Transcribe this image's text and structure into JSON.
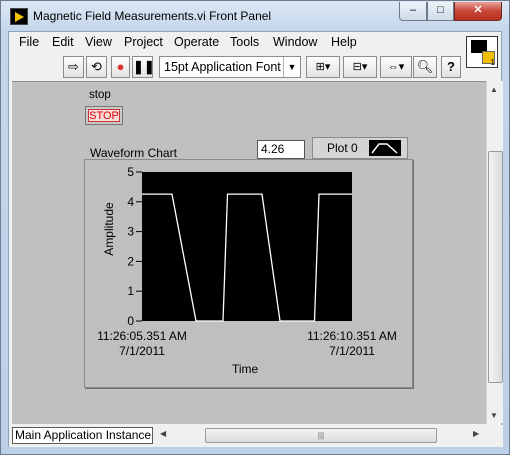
{
  "window": {
    "title": "Magnetic Field Measurements.vi Front Panel",
    "min": "–",
    "max": "□",
    "close": "✕"
  },
  "menu": [
    "File",
    "Edit",
    "View",
    "Project",
    "Operate",
    "Tools",
    "Window",
    "Help"
  ],
  "toolbar": {
    "font": "15pt Application Font",
    "connector_number": "1"
  },
  "controls": {
    "stop_label": "stop",
    "stop_text": "STOP"
  },
  "chart": {
    "label": "Waveform Chart",
    "digital_value": "4.26",
    "legend_plot": "Plot 0",
    "y_label": "Amplitude",
    "x_label": "Time",
    "y_ticks": [
      "0",
      "1",
      "2",
      "3",
      "4",
      "5"
    ],
    "x_start_time": "11:26:05.351 AM",
    "x_start_date": "7/1/2011",
    "x_end_time": "11:26:10.351 AM",
    "x_end_date": "7/1/2011"
  },
  "chart_data": {
    "type": "line",
    "xlabel": "Time",
    "ylabel": "Amplitude",
    "ylim": [
      0,
      5
    ],
    "xlim": [
      "11:26:05.351 AM",
      "11:26:10.351 AM"
    ],
    "series": [
      {
        "color": "#ffffff",
        "points": [
          [
            0,
            4.26
          ],
          [
            0.2,
            4.26
          ],
          [
            0.36,
            0
          ],
          [
            0.54,
            0
          ],
          [
            0.57,
            4.26
          ],
          [
            0.8,
            4.26
          ],
          [
            0.92,
            0
          ],
          [
            1.15,
            0
          ],
          [
            1.18,
            4.26
          ],
          [
            1.4,
            4.26
          ]
        ]
      }
    ]
  },
  "status": {
    "instance": "Main Application Instance"
  },
  "colors": {
    "panel": "#c0c0c0",
    "plot_bg": "#000000",
    "stop_red": "#dd0000"
  }
}
